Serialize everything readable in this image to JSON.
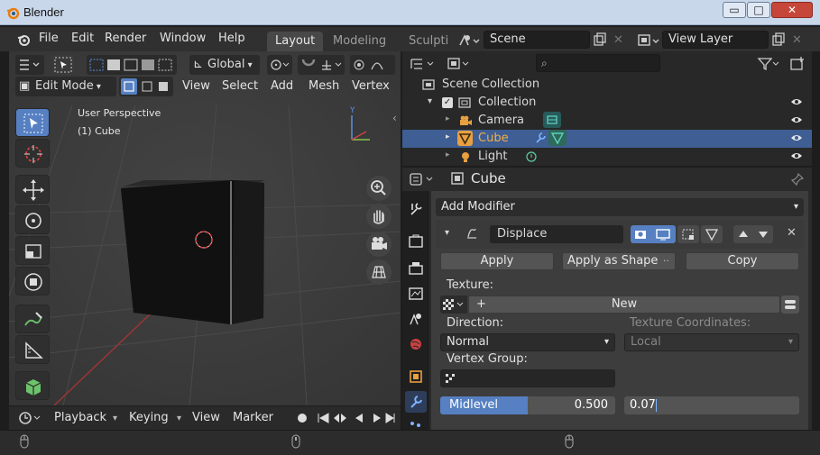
{
  "window": {
    "title": "Blender",
    "controls": [
      "▭",
      "□",
      "✕"
    ]
  },
  "menu": [
    "File",
    "Edit",
    "Render",
    "Window",
    "Help"
  ],
  "workspaces": [
    "Layout",
    "Modeling",
    "Sculpti"
  ],
  "scene": {
    "name": "Scene",
    "view_layer": "View Layer"
  },
  "viewport": {
    "orientation": "Global",
    "mode": "Edit Mode",
    "menus": [
      "View",
      "Select",
      "Add",
      "Mesh",
      "Vertex"
    ],
    "overlay_perspective": "User Perspective",
    "overlay_object": "(1) Cube",
    "gizmo_axes": {
      "y": "Y"
    }
  },
  "timeline": {
    "menus": [
      "Playback",
      "Keying",
      "View",
      "Marker"
    ]
  },
  "outliner": {
    "search_placeholder": "",
    "items": [
      {
        "label": "Scene Collection"
      },
      {
        "label": "Collection"
      },
      {
        "label": "Camera"
      },
      {
        "label": "Cube"
      },
      {
        "label": "Light"
      }
    ]
  },
  "properties": {
    "object_name": "Cube",
    "add_modifier": "Add Modifier",
    "modifier": {
      "name": "Displace",
      "apply": "Apply",
      "apply_as_shape": "Apply as Shape",
      "copy": "Copy",
      "texture_label": "Texture:",
      "texture_new": "New",
      "direction_label": "Direction:",
      "direction_value": "Normal",
      "texcoords_label": "Texture Coordinates:",
      "texcoords_value": "Local",
      "vertex_group_label": "Vertex Group:",
      "midlevel_label": "Midlevel",
      "midlevel_value": "0.500",
      "midlevel_fraction": 0.5,
      "strength_value": "0.07"
    }
  },
  "colors": {
    "accent": "#5680c2",
    "selection": "#3e5e94",
    "object_orange": "#e8a040"
  }
}
